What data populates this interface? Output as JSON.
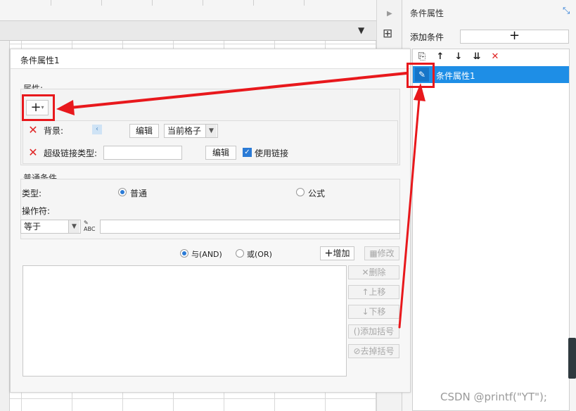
{
  "right_panel": {
    "title": "条件属性",
    "add_condition_label": "添加条件",
    "add_button": "+",
    "list_items": [
      {
        "label": "条件属性1",
        "icon": "edit-icon",
        "selected": true
      }
    ],
    "toolbar_icons": [
      "copy-icon",
      "arrow-up-icon",
      "arrow-down-icon",
      "move-bottom-icon",
      "delete-icon"
    ]
  },
  "dialog": {
    "title": "条件属性1",
    "attributes_label": "属性:",
    "add_attr_button": "+",
    "background": {
      "label": "背景:",
      "edit_button": "编辑",
      "scope_select": "当前格子"
    },
    "hyperlink": {
      "label": "超级链接类型:",
      "value": "",
      "edit_button": "编辑",
      "use_link_label": "使用链接",
      "use_link_checked": true
    },
    "normal_condition": {
      "section_label": "普通条件",
      "type_label": "类型:",
      "type_normal": "普通",
      "type_formula": "公式",
      "selected_type": "普通",
      "operator_label": "操作符:",
      "operator_value": "等于",
      "operand_value": ""
    },
    "logic": {
      "and_label": "与(AND)",
      "or_label": "或(OR)",
      "selected": "与(AND)"
    },
    "buttons": {
      "add": "增加",
      "modify": "修改",
      "delete": "删除",
      "move_up": "上移",
      "move_down": "下移",
      "add_bracket": "添加括号",
      "remove_bracket": "去掉括号"
    }
  },
  "watermark": "CSDN @‍printf(\"YT\");",
  "colors": {
    "accent": "#1e8ee6",
    "highlight": "#e8181c",
    "delete_red": "#e02424"
  }
}
